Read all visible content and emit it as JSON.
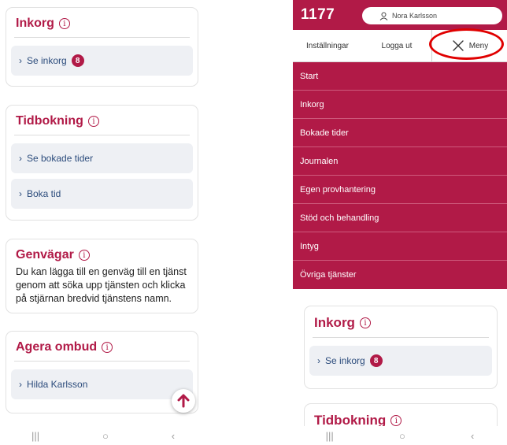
{
  "left": {
    "inbox_card": {
      "title": "Inkorg",
      "info": "i",
      "link": "Se inkorg",
      "badge": "8"
    },
    "booking_card": {
      "title": "Tidbokning",
      "info": "i",
      "links": [
        "Se bokade tider",
        "Boka tid"
      ]
    },
    "shortcuts_card": {
      "title": "Genvägar",
      "info": "i",
      "lines": [
        "Du kan lägga till en genväg till en tjänst",
        "genom att söka upp tjänsten och klicka",
        "på stjärnan bredvid tjänstens namn."
      ]
    },
    "proxy_card": {
      "title": "Agera ombud",
      "info": "i",
      "link": "Hilda Karlsson"
    }
  },
  "right": {
    "logo": "1177",
    "user_name": "Nora Karlsson",
    "settings_label": "Inställningar",
    "logout_label": "Logga ut",
    "menu_label": "Meny",
    "menu_items": [
      "Start",
      "Inkorg",
      "Bokade tider",
      "Journalen",
      "Egen provhantering",
      "Stöd och behandling",
      "Intyg",
      "Övriga tjänster"
    ],
    "inbox_card": {
      "title": "Inkorg",
      "info": "i",
      "link": "Se inkorg",
      "badge": "8"
    },
    "booking_card": {
      "title": "Tidbokning",
      "info": "i"
    }
  },
  "colors": {
    "brand": "#b11a47",
    "highlight_ring": "#e00000",
    "row_bg": "#eef0f4",
    "link": "#2c4c7c"
  },
  "icons": [
    "info-icon",
    "chevron-right-icon",
    "arrow-up-icon",
    "user-icon",
    "close-icon",
    "recent-apps-icon",
    "home-icon",
    "back-icon"
  ]
}
